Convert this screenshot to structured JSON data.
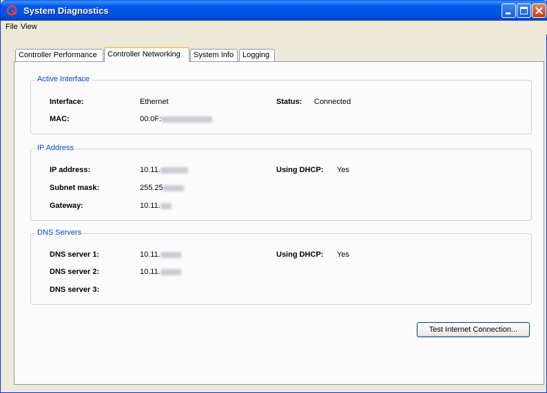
{
  "window": {
    "title": "System Diagnostics"
  },
  "menu": {
    "items": [
      "File",
      "View"
    ]
  },
  "tabs": [
    "Controller Performance",
    "Controller Networking",
    "System Info",
    "Logging"
  ],
  "active_interface": {
    "title": "Active Interface",
    "interface_label": "Interface:",
    "interface_value": "Ethernet",
    "status_label": "Status:",
    "status_value": "Connected",
    "mac_label": "MAC:",
    "mac_value": "00:0F:"
  },
  "ip_address": {
    "title": "IP Address",
    "ip_label": "IP address:",
    "ip_value": "10.11.",
    "dhcp_label": "Using DHCP:",
    "dhcp_value": "Yes",
    "subnet_label": "Subnet mask:",
    "subnet_value": "255.25",
    "gateway_label": "Gateway:",
    "gateway_value": "10.11."
  },
  "dns": {
    "title": "DNS Servers",
    "dns1_label": "DNS server 1:",
    "dns1_value": "10.11.",
    "dhcp_label": "Using DHCP:",
    "dhcp_value": "Yes",
    "dns2_label": "DNS server 2:",
    "dns2_value": "10.11.",
    "dns3_label": "DNS server 3:"
  },
  "buttons": {
    "test_connection": "Test Internet Connection..."
  }
}
